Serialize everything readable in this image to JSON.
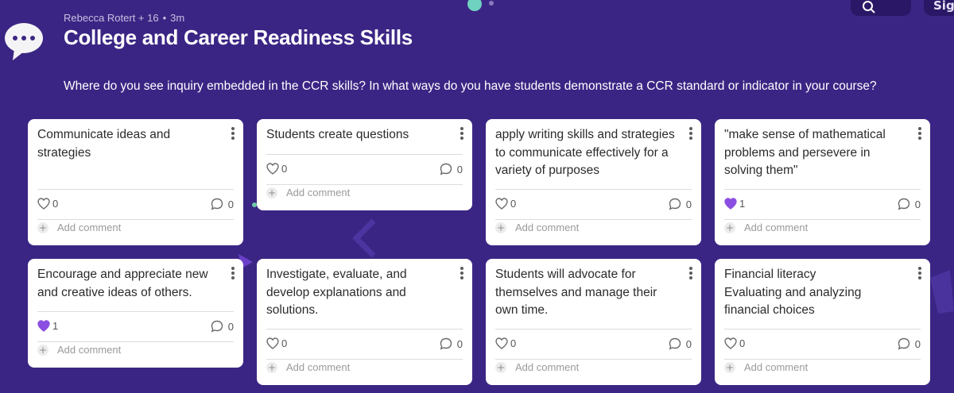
{
  "meta": {
    "author": "Rebecca Rotert + 16",
    "separator": "•",
    "time": "3m"
  },
  "title": "College and Career Readiness Skills",
  "description": "Where do you see inquiry embedded in the CCR skills? In what ways do you have students demonstrate a CCR standard or indicator in your course?",
  "topbar": {
    "signup_label": "Sig"
  },
  "colors": {
    "background": "#3b2584",
    "liked_heart": "#8a4fe0",
    "card": "#ffffff"
  },
  "icons": {
    "avatar": "speech-bubble-icon",
    "search": "search-icon",
    "menu": "kebab-menu-icon",
    "like": "heart-icon",
    "comment": "comment-icon",
    "add": "plus-icon"
  },
  "add_comment_label": "Add comment",
  "cards": [
    {
      "text": "Communicate ideas and strategies",
      "likes": "0",
      "liked": false,
      "comments": "0"
    },
    {
      "text": "Students create questions",
      "likes": "0",
      "liked": false,
      "comments": "0"
    },
    {
      "text": "apply writing skills and strategies to communicate effectively for a variety of purposes",
      "likes": "0",
      "liked": false,
      "comments": "0"
    },
    {
      "text": "\"make sense of mathematical problems and persevere in solving them\"",
      "likes": "1",
      "liked": true,
      "comments": "0"
    },
    {
      "text": "Encourage and appreciate new and creative ideas of others.",
      "likes": "1",
      "liked": true,
      "comments": "0"
    },
    {
      "text": "Investigate, evaluate, and develop explanations and solutions.",
      "likes": "0",
      "liked": false,
      "comments": "0"
    },
    {
      "text": "Students will advocate for themselves and manage their own time.",
      "likes": "0",
      "liked": false,
      "comments": "0"
    },
    {
      "text": "Financial literacy\nEvaluating and analyzing financial choices",
      "likes": "0",
      "liked": false,
      "comments": "0"
    }
  ]
}
